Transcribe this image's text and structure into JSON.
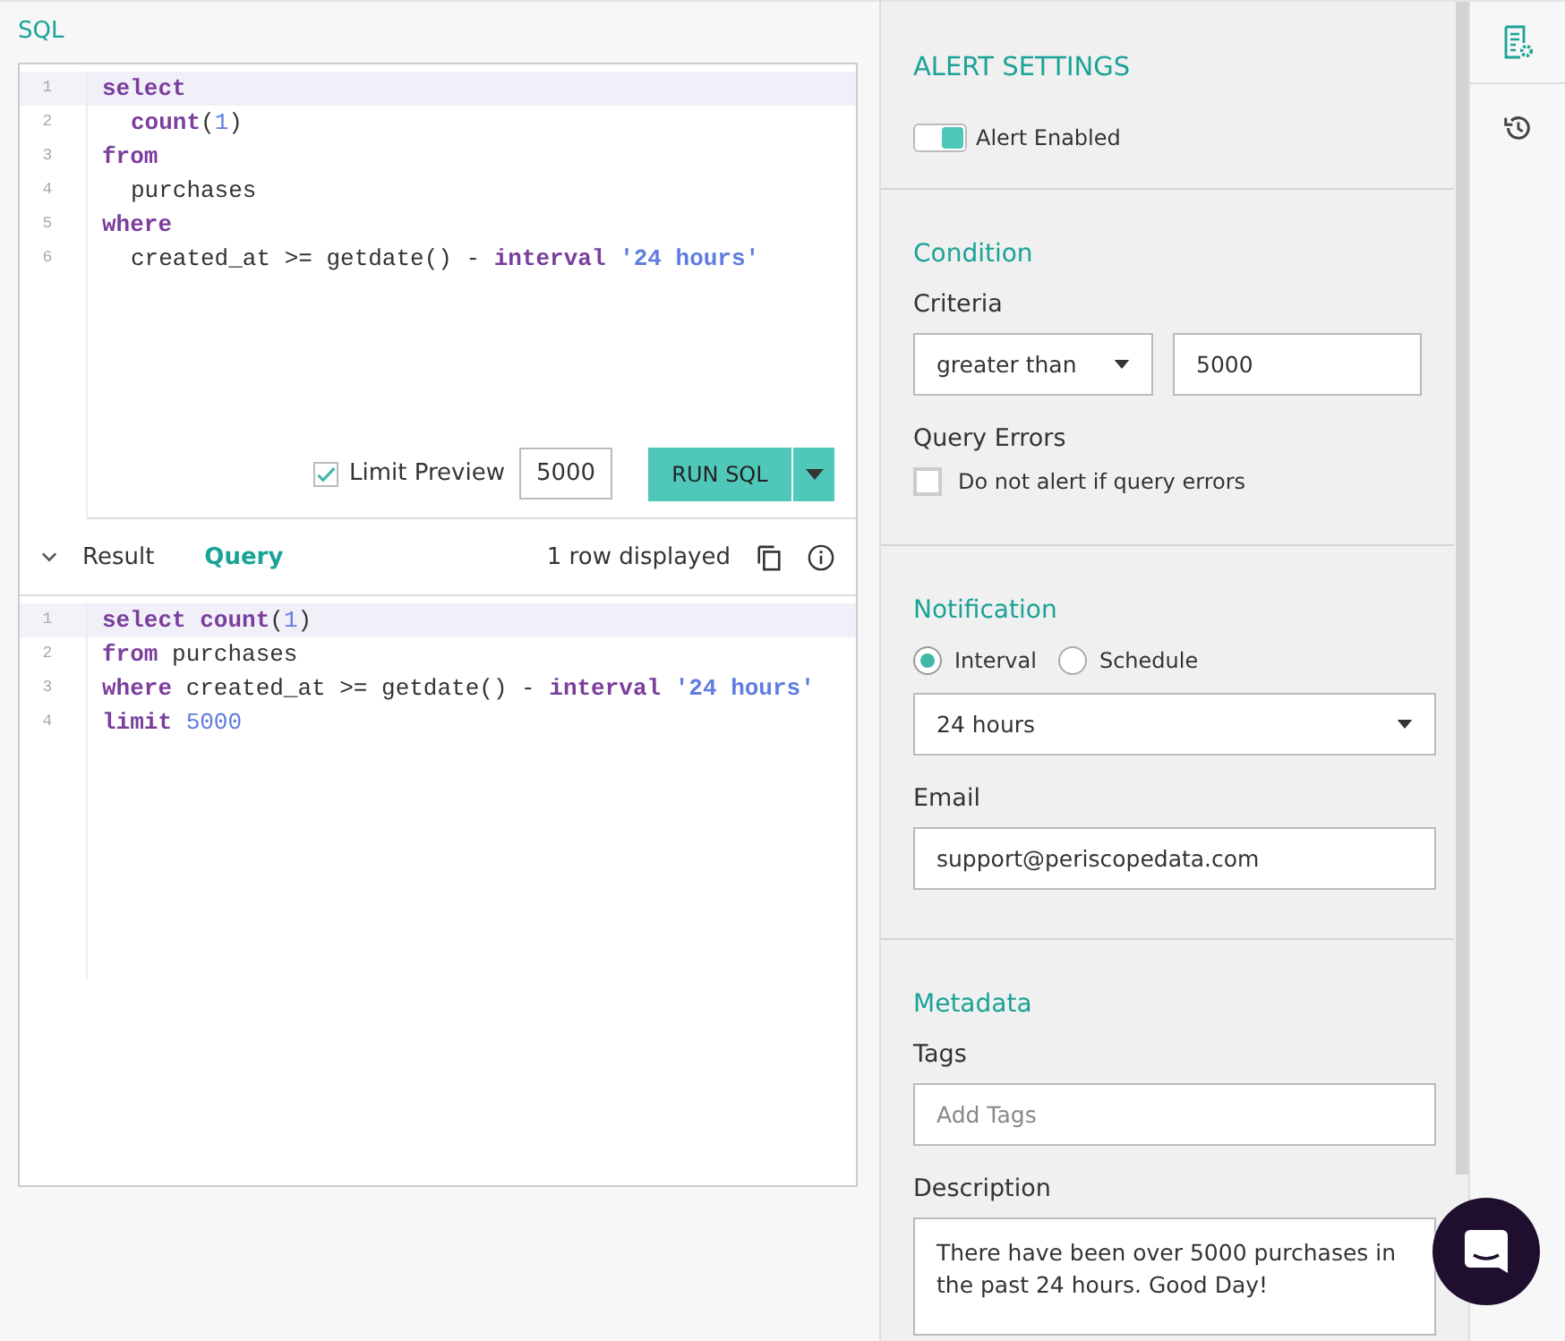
{
  "sql": {
    "title": "SQL",
    "lines": [
      {
        "indent": false,
        "tokens": [
          {
            "t": "select",
            "kind": "kw"
          }
        ]
      },
      {
        "indent": true,
        "tokens": [
          {
            "t": "count",
            "kind": "kw"
          },
          {
            "t": "(",
            "kind": "plain"
          },
          {
            "t": "1",
            "kind": "num"
          },
          {
            "t": ")",
            "kind": "plain"
          }
        ]
      },
      {
        "indent": false,
        "tokens": [
          {
            "t": "from",
            "kind": "kw"
          }
        ]
      },
      {
        "indent": true,
        "tokens": [
          {
            "t": "purchases",
            "kind": "plain"
          }
        ]
      },
      {
        "indent": false,
        "tokens": [
          {
            "t": "where",
            "kind": "kw"
          }
        ]
      },
      {
        "indent": true,
        "tokens": [
          {
            "t": "created_at >= getdate() -",
            "kind": "plain"
          },
          {
            "t": "interval",
            "kind": "kw",
            "gap": true
          },
          {
            "t": "'24 hours'",
            "kind": "str",
            "gap": true
          }
        ]
      }
    ],
    "line_numbers": [
      "1",
      "2",
      "3",
      "4",
      "5",
      "6"
    ],
    "limit_preview": {
      "label": "Limit Preview",
      "checked": true,
      "value": "5000"
    },
    "run_button": "RUN SQL"
  },
  "result": {
    "tabs": [
      {
        "label": "Result",
        "selected": false
      },
      {
        "label": "Query",
        "selected": true
      }
    ],
    "rows_info": "1 row displayed",
    "line_numbers": [
      "1",
      "2",
      "3",
      "4"
    ],
    "lines": [
      {
        "indent": false,
        "tokens": [
          {
            "t": "select",
            "kind": "kw"
          },
          {
            "t": "count",
            "kind": "kw",
            "gap": true
          },
          {
            "t": "(",
            "kind": "plain"
          },
          {
            "t": "1",
            "kind": "num"
          },
          {
            "t": ")",
            "kind": "plain"
          }
        ]
      },
      {
        "indent": false,
        "tokens": [
          {
            "t": "from",
            "kind": "kw"
          },
          {
            "t": "purchases",
            "kind": "plain",
            "gap": true
          }
        ]
      },
      {
        "indent": false,
        "tokens": [
          {
            "t": "where",
            "kind": "kw"
          },
          {
            "t": "created_at >= getdate() -",
            "kind": "plain",
            "gap": true
          },
          {
            "t": "interval",
            "kind": "kw",
            "gap": true
          },
          {
            "t": "'24 hours'",
            "kind": "str",
            "gap": true
          }
        ]
      },
      {
        "indent": false,
        "tokens": [
          {
            "t": "limit",
            "kind": "kw"
          },
          {
            "t": "5000",
            "kind": "num",
            "gap": true
          }
        ]
      }
    ]
  },
  "alert_settings": {
    "title": "ALERT SETTINGS",
    "toggle": {
      "label": "Alert Enabled",
      "on": true
    },
    "condition": {
      "title": "Condition",
      "criteria_label": "Criteria",
      "operator": "greater than",
      "threshold": "5000",
      "errors_label": "Query Errors",
      "errors_option": {
        "label": "Do not alert if query errors",
        "checked": false
      }
    },
    "notification": {
      "title": "Notification",
      "modes": [
        {
          "label": "Interval",
          "selected": true
        },
        {
          "label": "Schedule",
          "selected": false
        }
      ],
      "interval": "24 hours",
      "email_label": "Email",
      "email": "support@periscopedata.com"
    },
    "metadata": {
      "title": "Metadata",
      "tags_label": "Tags",
      "tags_placeholder": "Add Tags",
      "description_label": "Description",
      "description": "There have been over 5000 purchases in the past 24 hours. Good Day!"
    }
  },
  "side_tabs": [
    {
      "kind": "settings",
      "selected": true
    },
    {
      "kind": "history",
      "selected": false
    }
  ]
}
